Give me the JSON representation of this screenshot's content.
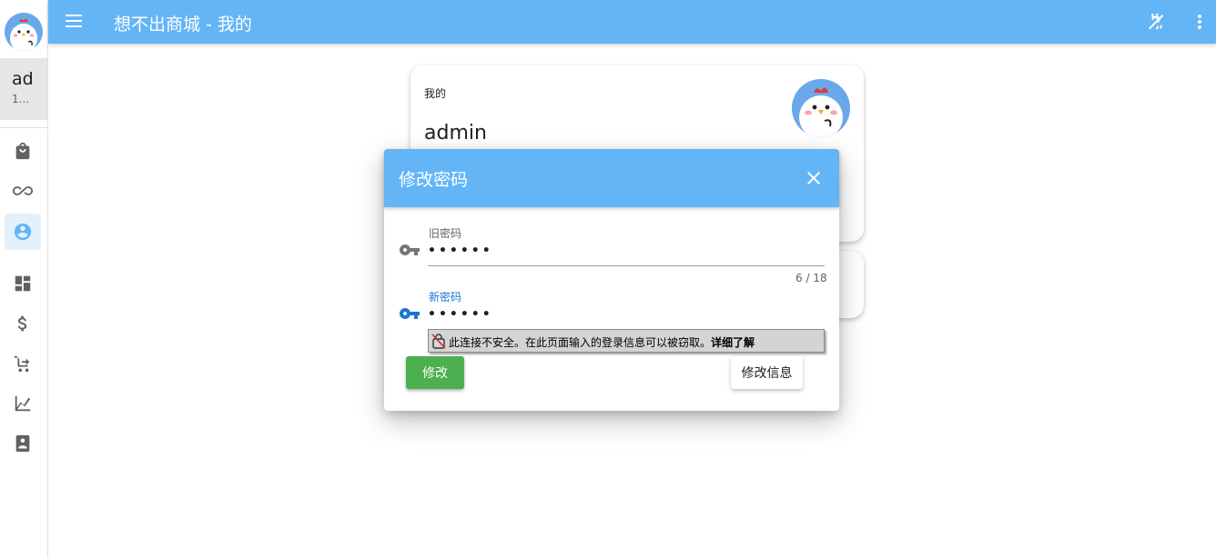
{
  "app": {
    "title": "想不出商城 - 我的"
  },
  "sidebar": {
    "user": {
      "name": "ad",
      "sub": "1..."
    },
    "items": [
      {
        "icon": "shopping-bag-icon"
      },
      {
        "icon": "infinity-icon"
      },
      {
        "icon": "account-circle-icon",
        "active": true
      },
      {
        "icon": "dashboard-icon"
      },
      {
        "icon": "dollar-icon"
      },
      {
        "icon": "cart-arrow-icon"
      },
      {
        "icon": "chart-icon"
      },
      {
        "icon": "contact-book-icon"
      }
    ]
  },
  "topbar": {
    "icons": [
      "image-off-icon",
      "more-vertical-icon"
    ]
  },
  "profile_card": {
    "label": "我的",
    "name": "admin"
  },
  "dialog": {
    "title": "修改密码",
    "old_password": {
      "label": "旧密码",
      "value": "••••••",
      "counter": "6 / 18"
    },
    "new_password": {
      "label": "新密码",
      "value": "••••••"
    },
    "warning": {
      "text": "此连接不安全。在此页面输入的登录信息可以被窃取。",
      "link": "详细了解"
    },
    "submit_label": "修改",
    "info_label": "修改信息"
  },
  "colors": {
    "primary": "#64b5f6",
    "success": "#4caf50",
    "focus": "#1976d2"
  }
}
